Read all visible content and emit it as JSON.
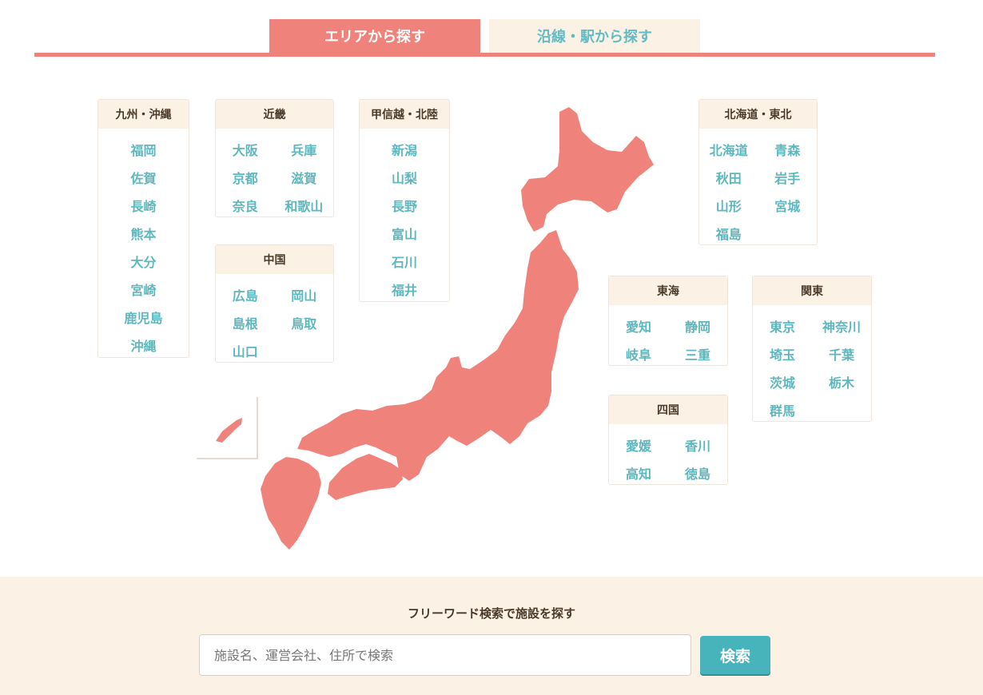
{
  "tabs": {
    "area": "エリアから探す",
    "line": "沿線・駅から探す"
  },
  "regions": {
    "kyushu": {
      "title": "九州・沖縄",
      "prefs": [
        "福岡",
        "佐賀",
        "長崎",
        "熊本",
        "大分",
        "宮崎",
        "鹿児島",
        "沖縄"
      ]
    },
    "kinki": {
      "title": "近畿",
      "prefs": [
        "大阪",
        "兵庫",
        "京都",
        "滋賀",
        "奈良",
        "和歌山"
      ]
    },
    "chugoku": {
      "title": "中国",
      "prefs": [
        "広島",
        "岡山",
        "島根",
        "鳥取",
        "山口"
      ]
    },
    "koshinetsu": {
      "title": "甲信越・北陸",
      "prefs": [
        "新潟",
        "山梨",
        "長野",
        "富山",
        "石川",
        "福井"
      ]
    },
    "hokkaido": {
      "title": "北海道・東北",
      "prefs": [
        "北海道",
        "青森",
        "秋田",
        "岩手",
        "山形",
        "宮城",
        "福島"
      ]
    },
    "tokai": {
      "title": "東海",
      "prefs": [
        "愛知",
        "静岡",
        "岐阜",
        "三重"
      ]
    },
    "kanto": {
      "title": "関東",
      "prefs": [
        "東京",
        "神奈川",
        "埼玉",
        "千葉",
        "茨城",
        "栃木",
        "群馬"
      ]
    },
    "shikoku": {
      "title": "四国",
      "prefs": [
        "愛媛",
        "香川",
        "高知",
        "徳島"
      ]
    }
  },
  "colors": {
    "accent": "#ef837b",
    "link": "#5eb7be",
    "header_bg": "#fcf1e5",
    "button": "#47b4bc"
  },
  "search": {
    "title": "フリーワード検索で施設を探す",
    "placeholder": "施設名、運営会社、住所で検索",
    "value": "",
    "button_label": "検索"
  }
}
